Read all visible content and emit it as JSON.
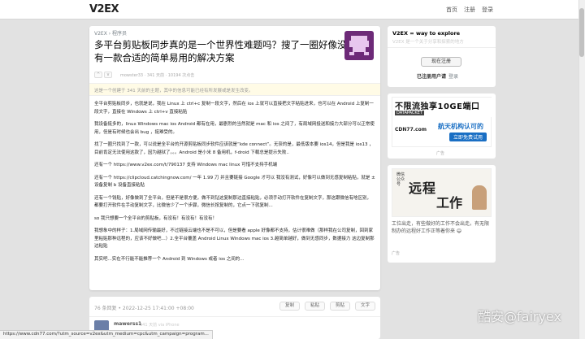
{
  "header": {
    "logo": "V2EX",
    "nav": [
      "首页",
      "注册",
      "登录"
    ]
  },
  "topic": {
    "breadcrumb": "V2EX › 程序员",
    "title": "多平台剪贴板同步真的是一个世界性难题吗？搜了一圈好像没有一款合适的简单易用的解决方案",
    "meta": "mowster33 · 341 天前 · 10194 次点击",
    "notice": "这是一个创建于 341 天前的主题，其中的信息可能已经有所发展或是发生改变。",
    "paragraphs": [
      "全平台剪贴板同步，也就是说，我在 Linux 上 ctrl+c 复制一段文字，然后在 ios 上就可以直接把文字粘贴进来，也可以在 Android 上复制一段文字，直接在 Windows 上 ctrl+v 直接粘贴",
      "我设备挺多的，linux Windows mac ios Android 都有在用，最剧烈的当然就是 mac 和 ios 之间了，有局域网投送和接力大部分可以正常使用，但是有时候也会出 bug ，挺难受的。",
      "找了一圈只找到了一款，可以说是全平台的开源剪贴板同步软件应该就是“kde connect”。无奈的是，最低版本要 ios14，但是我是 ios13 ，目前肯定无法使用这款了，因为越狱了。。。Android 是小米 8 备用机，f-droid 下载总是提示失败..",
      "还有一个 https://www.v2ex.com/t/790137 支持 Windows mac linux 可惜不支持手机端",
      "还有一个 https://clipcloud.catchingnow.com/ 一年 1.99 刀 并且要链接 Google 才可以 我没有测试，好像可以做到无感复制粘贴，就是 ± 设备复制 b 设备直接粘贴",
      "还有一个钱贴，好像做到了全平台，但是不是很方便，做不到钻这复制那边直接粘贴，必须手动打开软件在复制文字，那这跟微信有啥区别，都要打开软件在手动复制文字，比微信少了一个步骤，微信长按复制的，它点一下就复制...",
      "so 我只想要一个全平台的剪贴板，有没有！有没有！有没有！",
      "我想象中的样子：1.局域网传输最好，不过链接云端也不是不可以，但是要看 apple 好像都不支持，估计很难做（那样我在公司复制，回到家里粘贴那种远程的，应该不好做吧...）2.全平台覆盖 Android Linux Windows mac ios 3.越简单越好，做到无感同步，数据接力 这边复制那边粘贴",
      "其实吧...实在不行能不能推荐一个 Android 到 Windows 或者 ios 之间的..."
    ],
    "links": [
      "https://www.v2ex.com/t/790137",
      "https://clipcloud.catchingnow.com/"
    ],
    "vote_up": "^",
    "vote_down": "v"
  },
  "replies": {
    "count_text": "76 条回复  •  2022-12-25 17:41:00 +08:00",
    "buttons": [
      "复制",
      "粘贴",
      "剪贴",
      "文字"
    ],
    "first_user": "mawerss1",
    "first_time": "341 天前  via iPhone"
  },
  "sidebar": {
    "title": "V2EX = way to explore",
    "subtitle": "V2EX 是一个关于分享和探索的地方",
    "register_button": "现在注册",
    "login_prompt": "已注册用户请",
    "login_link": "登录"
  },
  "ad1": {
    "headline": "不限流独享10GE端口",
    "brand_tag": "DATAPACKET",
    "cdn_name": "CDN77.com",
    "slogan": "航天机构认可的",
    "cta": "立即免费试用",
    "label": "广告"
  },
  "ad2": {
    "side_text": "微信公众号",
    "big1": "远程",
    "big2": "工作",
    "text": "工位出走，有些做好的工作不会出走。有无限制办的远程好工作正等着你来 😄",
    "label": "广告"
  },
  "statusbar": {
    "url": "https://www.cdn77.com/?utm_source=v2ex&utm_medium=cpc&utm_campaign=program..."
  },
  "watermark": "酷安@fairyex"
}
